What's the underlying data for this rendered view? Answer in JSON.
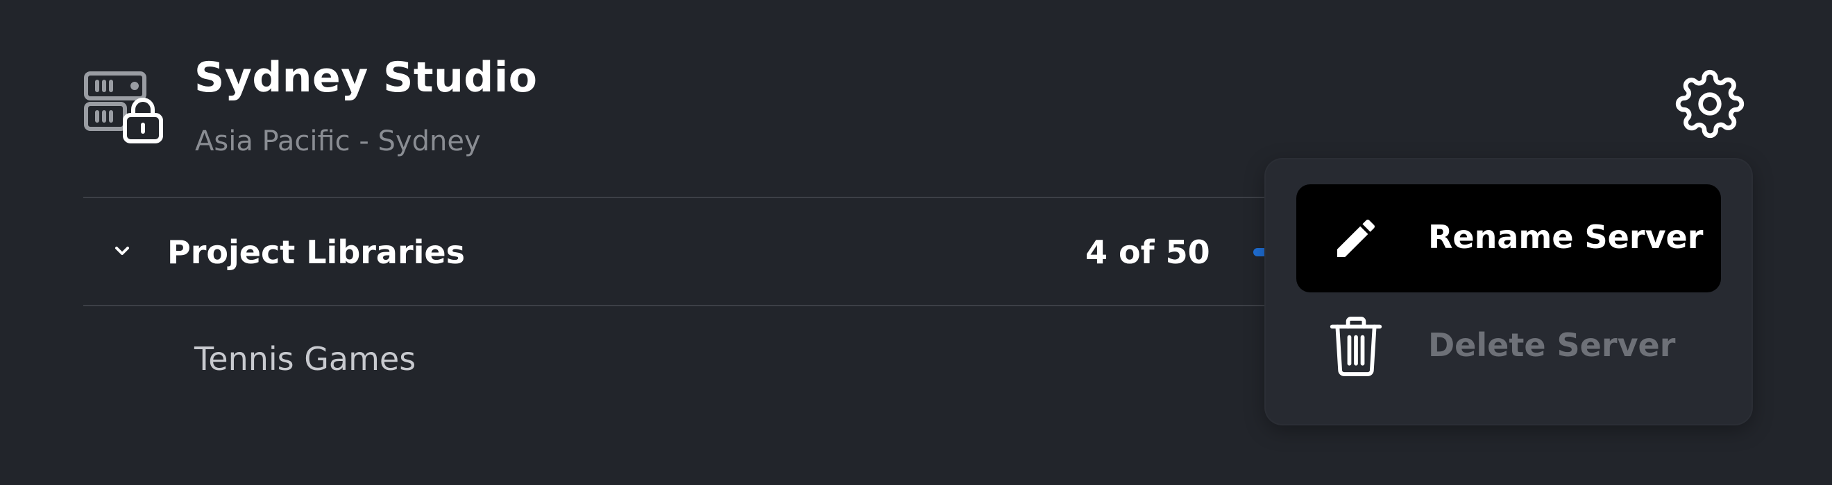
{
  "server": {
    "name": "Sydney Studio",
    "region": "Asia Pacific - Sydney",
    "icon": "server-lock-icon"
  },
  "settings": {
    "icon": "gear-icon"
  },
  "libraries": {
    "label": "Project Libraries",
    "count_text": "4 of 50",
    "usage": {
      "used": 4,
      "total": 50
    },
    "items": [
      {
        "label": "Tennis Games"
      }
    ]
  },
  "menu": {
    "items": [
      {
        "label": "Rename Server",
        "icon": "pencil-icon",
        "state": "highlighted"
      },
      {
        "label": "Delete Server",
        "icon": "trash-icon",
        "state": "disabled"
      }
    ]
  },
  "colors": {
    "background": "#22252b",
    "accent": "#1f6fd6",
    "menu_background": "#272a31",
    "menu_highlight": "#000000",
    "muted_text": "#8a8d93",
    "disabled_text": "#6e7178"
  }
}
